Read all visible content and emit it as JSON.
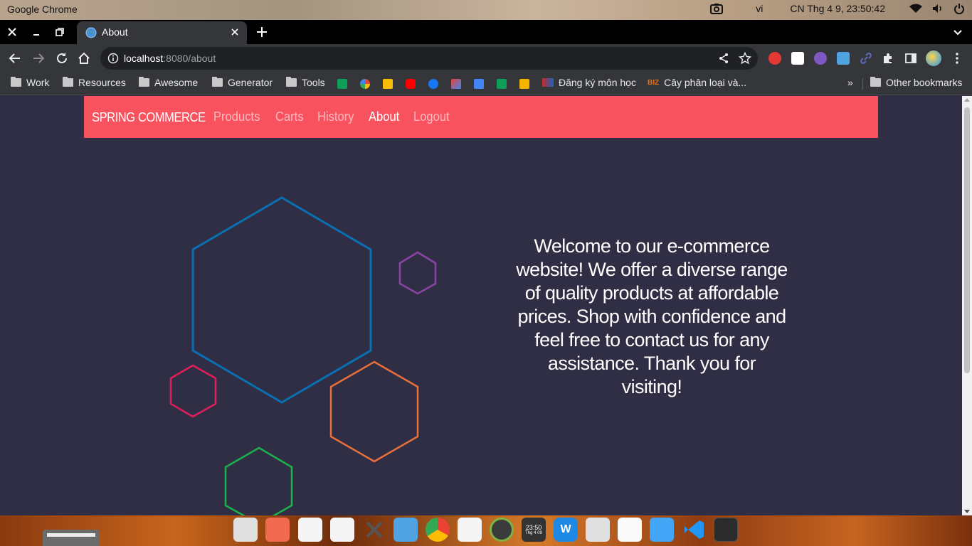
{
  "os": {
    "app_name": "Google Chrome",
    "language": "vi",
    "datetime": "CN Thg 4  9, 23:50:42"
  },
  "browser": {
    "tab_title": "About",
    "url_host": "localhost",
    "url_rest": ":8080/about",
    "bookmarks": [
      {
        "label": "Work",
        "type": "folder"
      },
      {
        "label": "Resources",
        "type": "folder"
      },
      {
        "label": "Awesome",
        "type": "folder"
      },
      {
        "label": "Generator",
        "type": "folder"
      },
      {
        "label": "Tools",
        "type": "folder"
      },
      {
        "label": "Đăng ký môn học",
        "type": "link"
      },
      {
        "label": "Cây phân loại và...",
        "type": "link"
      }
    ],
    "other_bookmarks": "Other bookmarks",
    "overflow": "»"
  },
  "navbar": {
    "brand": "SPRING COMMERCE",
    "links": [
      {
        "label": "Products",
        "active": false
      },
      {
        "label": "Carts",
        "active": false
      },
      {
        "label": "History",
        "active": false
      },
      {
        "label": "About",
        "active": true
      },
      {
        "label": "Logout",
        "active": false
      }
    ],
    "color": "#f9525f"
  },
  "content": {
    "welcome_text": "Welcome to our e-commerce website! We offer a diverse range of quality products at affordable prices. Shop with confidence and feel free to contact us for any assistance. Thank you for visiting!"
  },
  "hexagon_colors": {
    "large": "#0a6fb3",
    "small_purple": "#8a44a6",
    "pink": "#e11d5b",
    "orange": "#e8703a",
    "green": "#19b24b"
  },
  "dock": {
    "clock_time": "23:50",
    "clock_date": "Thg 4 09"
  }
}
